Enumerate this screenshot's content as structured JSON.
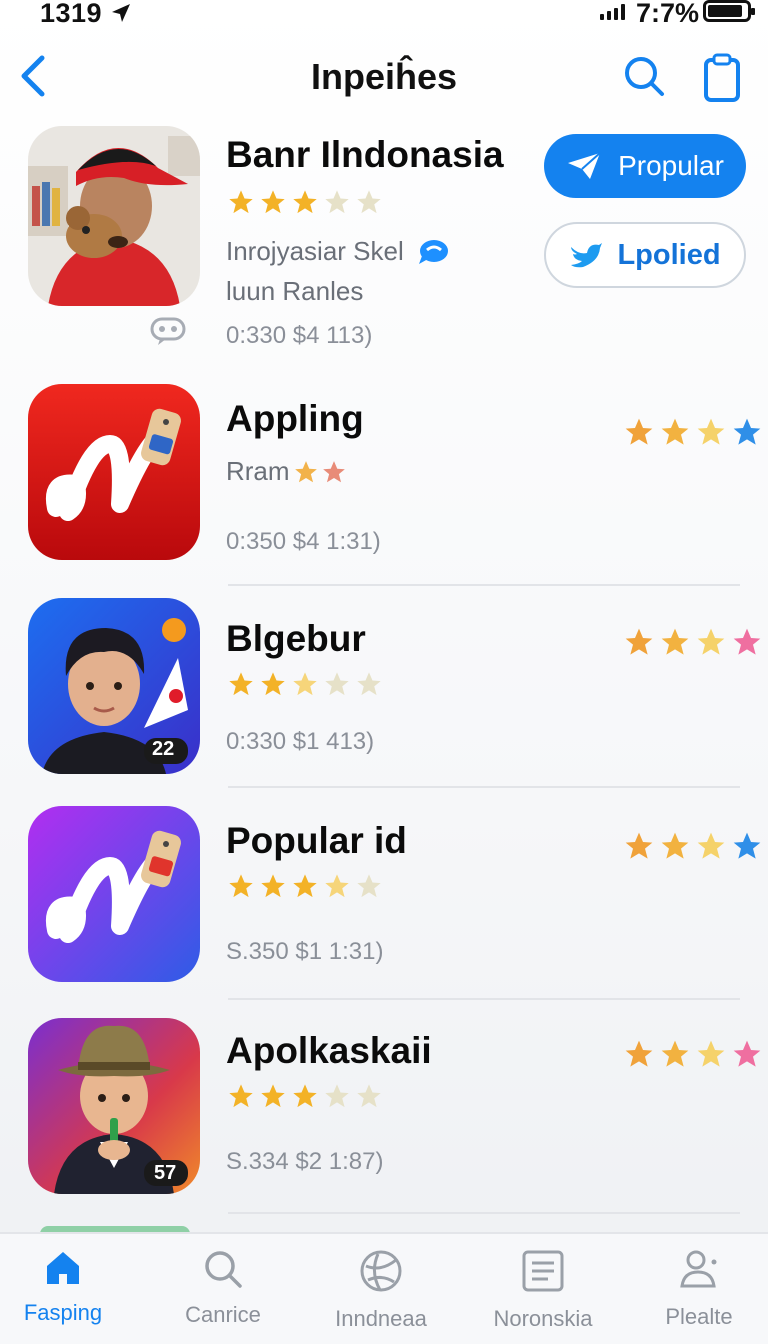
{
  "status_bar": {
    "time": "1319",
    "battery_text": "7:7%"
  },
  "nav": {
    "title": "Inpeiĥes"
  },
  "colors": {
    "accent": "#1482ef",
    "star": "#f3b227",
    "star_empty": "#e6e1c8"
  },
  "apps": [
    {
      "name": "Banr Ilndonasia",
      "rating_fraction": 0.6,
      "subtitle_line1": "Inrojyasiar Skel",
      "subtitle_line2": "luun Ranles",
      "meta": "0:330  $4 113)",
      "primary_button": "Propular",
      "secondary_button": "Lpolied"
    },
    {
      "name": "Appling",
      "subtitle": "Rram",
      "meta": "0:350  $4 1:31)",
      "right_rating_fraction": 0.8
    },
    {
      "name": "Blgebur",
      "rating_fraction": 0.5,
      "meta": "0:330  $1 413)",
      "badge": "22",
      "right_rating_fraction": 0.8
    },
    {
      "name": "Popular id",
      "rating_fraction": 0.65,
      "meta": "S.350  $1 1:31)",
      "right_rating_fraction": 0.8
    },
    {
      "name": "Apolkaskaii",
      "rating_fraction": 0.6,
      "meta": "S.334  $2 1:87)",
      "badge": "57",
      "right_rating_fraction": 0.7
    }
  ],
  "tabs": [
    {
      "label": "Fasping",
      "icon": "home-icon",
      "active": true
    },
    {
      "label": "Canrice",
      "icon": "search-icon",
      "active": false
    },
    {
      "label": "Inndneaa",
      "icon": "globe-icon",
      "active": false
    },
    {
      "label": "Noronskia",
      "icon": "document-icon",
      "active": false
    },
    {
      "label": "Plealte",
      "icon": "person-icon",
      "active": false
    }
  ]
}
